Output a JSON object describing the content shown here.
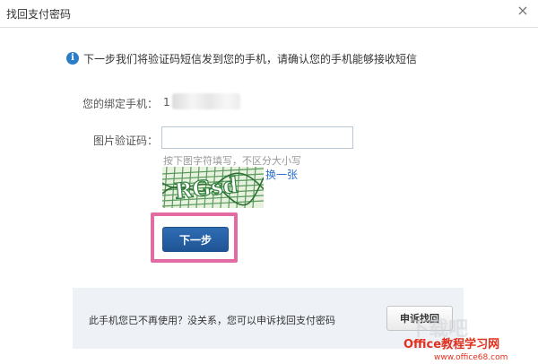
{
  "dialog": {
    "title": "找回支付密码",
    "close_glyph": "×"
  },
  "info": {
    "icon_glyph": "i",
    "message": "下一步我们将验证码短信发到您的手机，请确认您的手机能够接收短信"
  },
  "phone": {
    "label": "您的绑定手机：",
    "value_visible": "1"
  },
  "captcha": {
    "label": "图片验证码：",
    "input_value": "",
    "hint": "按下图字符填写，不区分大小写",
    "image_text": "RGsd",
    "refresh_label": "换一张"
  },
  "actions": {
    "next_label": "下一步",
    "highlight_color": "#e26ba3"
  },
  "footer": {
    "message": "此手机您已不再使用？没关系，您可以申诉找回支付密码",
    "appeal_label": "申诉找回"
  },
  "watermark": {
    "line1": "Office教程学习网",
    "line2": "www.office68.com"
  },
  "colors": {
    "accent_blue": "#2b7ec6",
    "button_blue": "#1f5596",
    "link_blue": "#2a6fc9",
    "captcha_green": "#2f7d3a",
    "footer_bg": "#eef2f7",
    "watermark_red": "#e0301e"
  }
}
